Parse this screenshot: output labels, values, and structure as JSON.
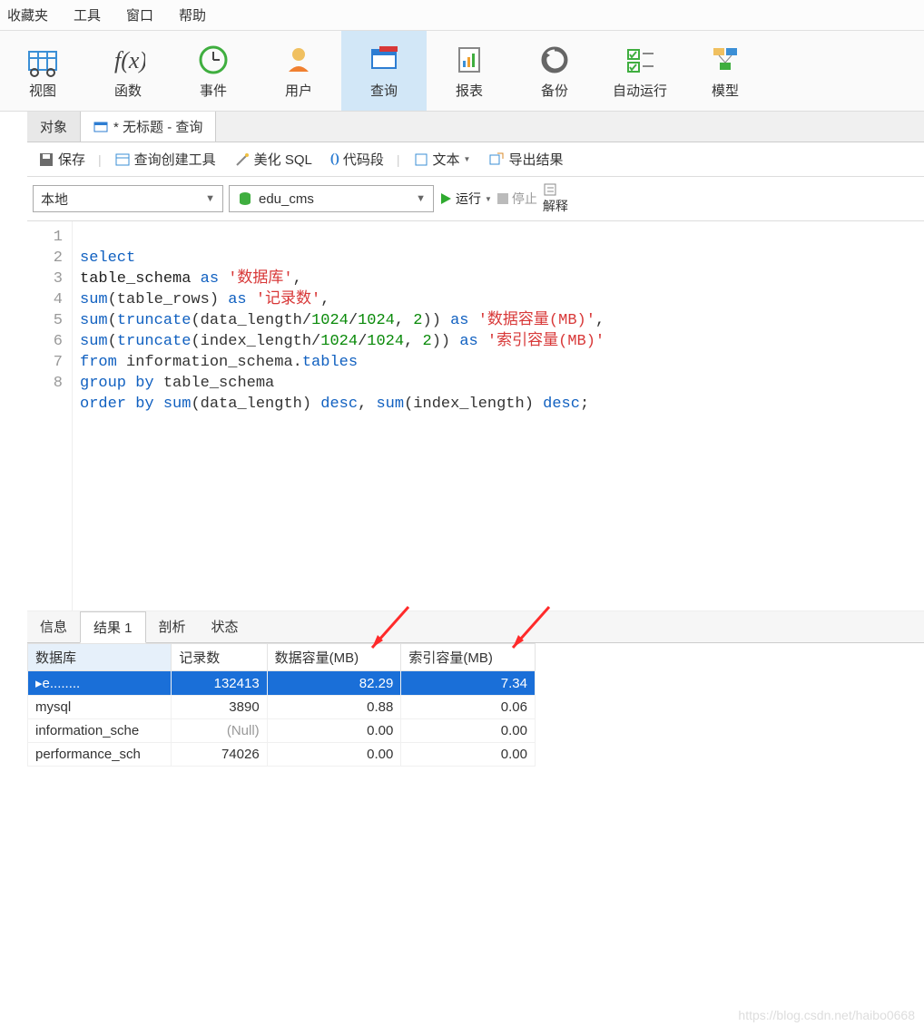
{
  "menu": [
    "收藏夹",
    "工具",
    "窗口",
    "帮助"
  ],
  "ribbon": [
    {
      "label": "视图",
      "icon": "grid"
    },
    {
      "label": "函数",
      "icon": "fx"
    },
    {
      "label": "事件",
      "icon": "clock"
    },
    {
      "label": "用户",
      "icon": "user"
    },
    {
      "label": "查询",
      "icon": "query",
      "active": true
    },
    {
      "label": "报表",
      "icon": "report"
    },
    {
      "label": "备份",
      "icon": "backup"
    },
    {
      "label": "自动运行",
      "icon": "auto"
    },
    {
      "label": "模型",
      "icon": "model"
    }
  ],
  "tabs": {
    "obj": "对象",
    "query": "* 无标题 - 查询"
  },
  "subtool": {
    "save": "保存",
    "builder": "查询创建工具",
    "beautify": "美化 SQL",
    "snippet": "代码段",
    "text": "文本",
    "export": "导出结果"
  },
  "conn": {
    "label": "本地"
  },
  "db": {
    "label": "edu_cms"
  },
  "exec": {
    "run": "运行",
    "stop": "停止",
    "explain": "解释"
  },
  "sql": {
    "lines": [
      "1",
      "2",
      "3",
      "4",
      "5",
      "6",
      "7",
      "8"
    ],
    "l1": "select",
    "l2a": "table_schema ",
    "l2b": "as ",
    "l2c": "'数据库'",
    "l3a": "sum",
    "l3b": "(table_rows) ",
    "l3c": "as ",
    "l3d": "'记录数'",
    "l4a": "sum",
    "l4b": "(",
    "l4c": "truncate",
    "l4d": "(data_length/",
    "l4e": "1024",
    "l4f": "/",
    "l4g": "1024",
    "l4h": ", ",
    "l4i": "2",
    "l4j": ")) ",
    "l4k": "as ",
    "l4l": "'数据容量(MB)'",
    "l5a": "sum",
    "l5b": "(",
    "l5c": "truncate",
    "l5d": "(index_length/",
    "l5e": "1024",
    "l5f": "/",
    "l5g": "1024",
    "l5h": ", ",
    "l5i": "2",
    "l5j": ")) ",
    "l5k": "as ",
    "l5l": "'索引容量(MB)'",
    "l6a": "from ",
    "l6b": "information_schema.",
    "l6c": "tables",
    "l7a": "group by ",
    "l7b": "table_schema",
    "l8a": "order by ",
    "l8b": "sum",
    "l8c": "(data_length) ",
    "l8d": "desc",
    "l8e": ", ",
    "l8f": "sum",
    "l8g": "(index_length) ",
    "l8h": "desc",
    "l8i": ";",
    "comma": ","
  },
  "result_tabs": {
    "info": "信息",
    "res": "结果 1",
    "profile": "剖析",
    "status": "状态"
  },
  "headers": {
    "c1": "数据库",
    "c2": "记录数",
    "c3": "数据容量(MB)",
    "c4": "索引容量(MB)"
  },
  "rows": [
    {
      "db": "e........",
      "rec": "132413",
      "d": "82.29",
      "i": "7.34"
    },
    {
      "db": "mysql",
      "rec": "3890",
      "d": "0.88",
      "i": "0.06"
    },
    {
      "db": "information_sche",
      "rec": "(Null)",
      "d": "0.00",
      "i": "0.00"
    },
    {
      "db": "performance_sch",
      "rec": "74026",
      "d": "0.00",
      "i": "0.00"
    }
  ],
  "watermark": "https://blog.csdn.net/haibo0668"
}
